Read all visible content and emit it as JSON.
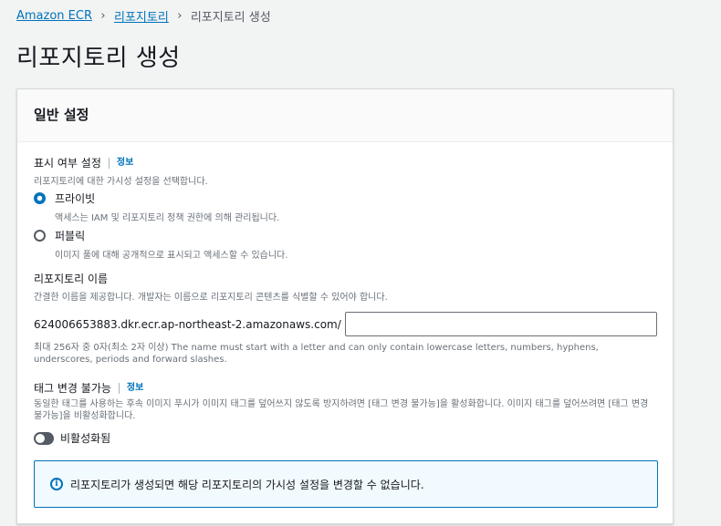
{
  "breadcrumb": {
    "items": [
      "Amazon ECR",
      "리포지토리",
      "리포지토리 생성"
    ],
    "separator": "›"
  },
  "page_title": "리포지토리 생성",
  "panel": {
    "title": "일반 설정",
    "visibility": {
      "label": "표시 여부 설정",
      "info": "정보",
      "description": "리포지토리에 대한 가시성 설정을 선택합니다.",
      "options": [
        {
          "label": "프라이빗",
          "description": "액세스는 IAM 및 리포지토리 정책 권한에 의해 관리됩니다.",
          "selected": true
        },
        {
          "label": "퍼블릭",
          "description": "이미지 풀에 대해 공개적으로 표시되고 액세스할 수 있습니다.",
          "selected": false
        }
      ]
    },
    "repo_name": {
      "label": "리포지토리 이름",
      "description": "간결한 이름을 제공합니다. 개발자는 이름으로 리포지토리 콘텐츠를 식별할 수 있어야 합니다.",
      "uri_prefix": "624006653883.dkr.ecr.ap-northeast-2.amazonaws.com/",
      "value": "",
      "constraint": "최대 256자 중 0자(최소 2자 이상) The name must start with a letter and can only contain lowercase letters, numbers, hyphens, underscores, periods and forward slashes."
    },
    "tag_immutability": {
      "label": "태그 변경 불가능",
      "info": "정보",
      "description": "동일한 태그를 사용하는 후속 이미지 푸시가 이미지 태그를 덮어쓰지 않도록 방지하려면 [태그 변경 불가능]을 활성화합니다. 이미지 태그를 덮어쓰려면 [태그 변경 불가능]을 비활성화합니다.",
      "toggle_label": "비활성화됨",
      "enabled": false
    },
    "alert": {
      "icon": "info-icon",
      "text": "리포지토리가 생성되면 해당 리포지토리의 가시성 설정을 변경할 수 없습니다."
    }
  },
  "colors": {
    "link": "#0073bb",
    "background": "#f2f3f3",
    "panel": "#ffffff",
    "info_box_bg": "#f1faff"
  }
}
